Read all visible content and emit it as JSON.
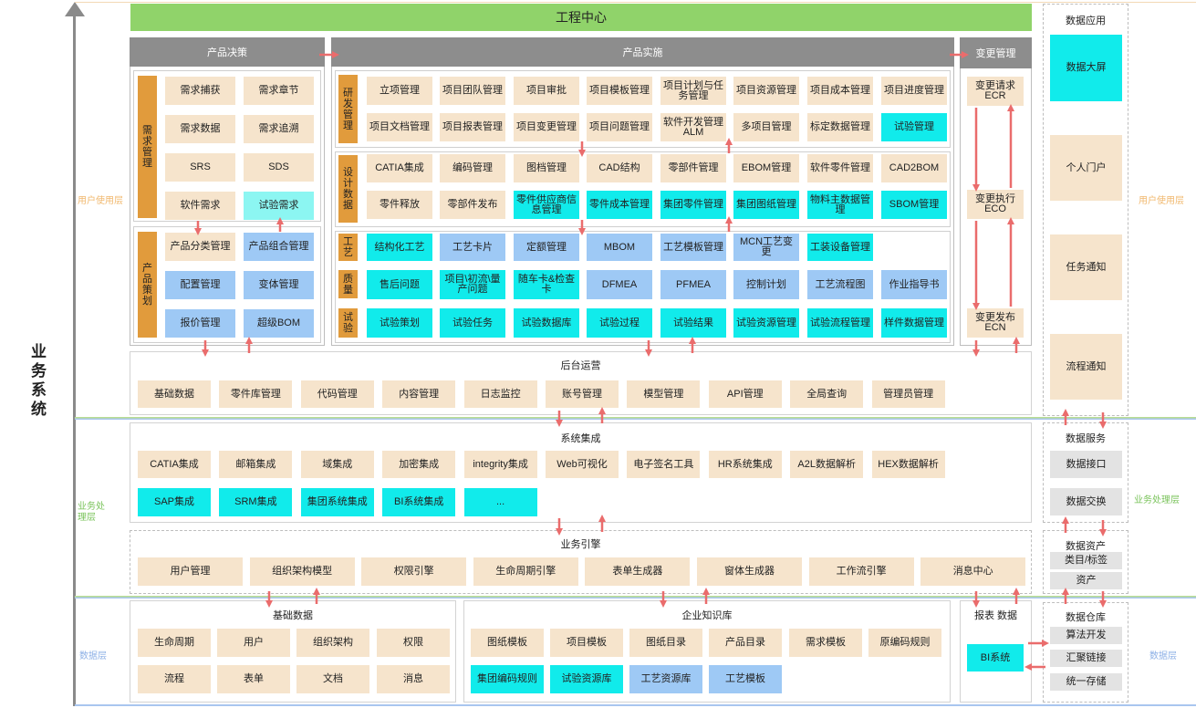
{
  "title": "工程中心",
  "system_label": "业务系统",
  "layers": {
    "user": "用户使用层",
    "business": "业务处理层",
    "data": "数据层"
  },
  "product_decision": {
    "title": "产品决策",
    "req_label": "需求管理",
    "req_items": [
      "需求捕获",
      "需求章节",
      "需求数据",
      "需求追溯",
      "SRS",
      "SDS",
      "软件需求",
      "试验需求"
    ],
    "plan_label": "产品策划",
    "plan_items": [
      "产品分类管理",
      "产品组合管理",
      "配置管理",
      "变体管理",
      "报价管理",
      "超级BOM"
    ]
  },
  "product_impl": {
    "title": "产品实施",
    "rd_label": "研发管理",
    "rd_items": [
      "立项管理",
      "项目团队管理",
      "项目审批",
      "项目模板管理",
      "项目计划与任务管理",
      "项目资源管理",
      "项目成本管理",
      "项目进度管理",
      "项目文档管理",
      "项目报表管理",
      "项目变更管理",
      "项目问题管理",
      "软件开发管理ALM",
      "多项目管理",
      "标定数据管理",
      "试验管理"
    ],
    "design_label": "设计数据",
    "design_items": [
      "CATIA集成",
      "编码管理",
      "图档管理",
      "CAD结构",
      "零部件管理",
      "EBOM管理",
      "软件零件管理",
      "CAD2BOM",
      "零件释放",
      "零部件发布",
      "零件供应商信息管理",
      "零件成本管理",
      "集团零件管理",
      "集团图纸管理",
      "物料主数据管理",
      "SBOM管理"
    ],
    "craft_label": "工艺",
    "craft_items": [
      "结构化工艺",
      "工艺卡片",
      "定额管理",
      "MBOM",
      "工艺模板管理",
      "MCN工艺变更",
      "工装设备管理"
    ],
    "quality_label": "质量",
    "quality_items": [
      "售后问题",
      "项目\\初流\\量产问题",
      "随车卡&检查卡",
      "DFMEA",
      "PFMEA",
      "控制计划",
      "工艺流程图",
      "作业指导书"
    ],
    "test_label": "试验",
    "test_items": [
      "试验策划",
      "试验任务",
      "试验数据库",
      "试验过程",
      "试验结果",
      "试验资源管理",
      "试验流程管理",
      "样件数据管理"
    ]
  },
  "change_mgmt": {
    "title": "变更管理",
    "items": [
      "变更请求ECR",
      "变更执行ECO",
      "变更发布ECN"
    ]
  },
  "data_app": {
    "title": "数据应用",
    "items": [
      "数据大屏",
      "个人门户",
      "任务通知",
      "流程通知"
    ]
  },
  "backend": {
    "title": "后台运营",
    "items": [
      "基础数据",
      "零件库管理",
      "代码管理",
      "内容管理",
      "日志监控",
      "账号管理",
      "模型管理",
      "API管理",
      "全局查询",
      "管理员管理"
    ]
  },
  "sys_integration": {
    "title": "系统集成",
    "row1": [
      "CATIA集成",
      "邮箱集成",
      "域集成",
      "加密集成",
      "integrity集成",
      "Web可视化",
      "电子签名工具",
      "HR系统集成",
      "A2L数据解析",
      "HEX数据解析"
    ],
    "row2": [
      "SAP集成",
      "SRM集成",
      "集团系统集成",
      "BI系统集成",
      "..."
    ]
  },
  "data_service": {
    "title": "数据服务",
    "items": [
      "数据接口",
      "数据交换"
    ]
  },
  "engine": {
    "title": "业务引擎",
    "items": [
      "用户管理",
      "组织架构模型",
      "权限引擎",
      "生命周期引擎",
      "表单生成器",
      "窗体生成器",
      "工作流引擎",
      "消息中心"
    ]
  },
  "data_asset": {
    "title": "数据资产",
    "items": [
      "类目/标签",
      "资产"
    ]
  },
  "base_data": {
    "title": "基础数据",
    "items": [
      "生命周期",
      "用户",
      "组织架构",
      "权限",
      "流程",
      "表单",
      "文档",
      "消息"
    ]
  },
  "knowledge": {
    "title": "企业知识库",
    "items": [
      "图纸模板",
      "项目模板",
      "图纸目录",
      "产品目录",
      "需求模板",
      "原编码规则",
      "集团编码规则",
      "试验资源库",
      "工艺资源库",
      "工艺模板"
    ]
  },
  "report": {
    "title": "报表 数据",
    "item": "BI系统"
  },
  "warehouse": {
    "title": "数据仓库",
    "items": [
      "算法开发",
      "汇聚链接",
      "统一存储"
    ]
  },
  "colors": {
    "beige": "#f6e4cc",
    "cyan": "#11ebeb",
    "blue": "#9ec9f5",
    "orange": "#e19b3c",
    "green": "#90d36a",
    "arrow": "#ea6c6c"
  }
}
